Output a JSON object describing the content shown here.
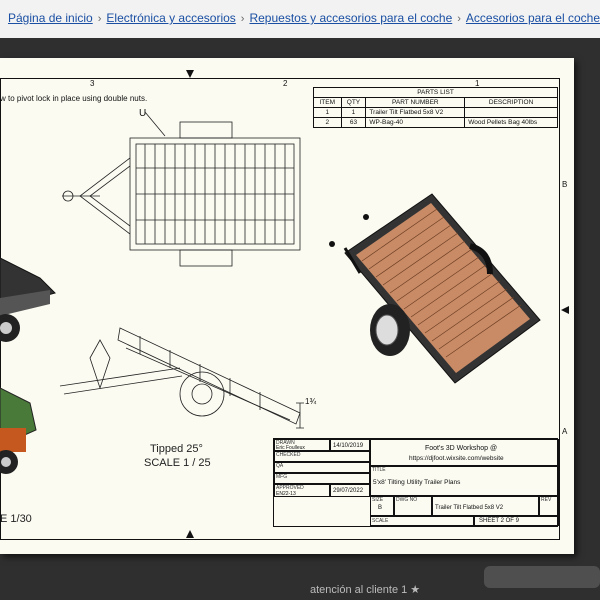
{
  "breadcrumb": [
    "Página de inicio",
    "Electrónica y accesorios",
    "Repuestos y accesorios para el coche",
    "Accesorios para el coche"
  ],
  "zones": {
    "top": [
      "3",
      "2",
      "1"
    ],
    "right": [
      "B",
      "A"
    ]
  },
  "note_pivot": "w to pivot lock in place using double nuts.",
  "label_u": "U",
  "dim_label": "1¾",
  "tipped": {
    "title": "Tipped 25°",
    "scale": "SCALE 1 / 25"
  },
  "left_scale": "E 1/30",
  "parts_list": {
    "title": "PARTS LIST",
    "headers": [
      "ITEM",
      "QTY",
      "PART NUMBER",
      "DESCRIPTION"
    ],
    "rows": [
      [
        "1",
        "1",
        "Trailer Tilt Flatbed 5x8 V2",
        ""
      ],
      [
        "2",
        "63",
        "WP-Bag-40",
        "Wood Pellets Bag 40lbs"
      ]
    ]
  },
  "title_block": {
    "drawn_label": "DRAWN",
    "drawn_name": "Eric Foulleux",
    "drawn_date": "14/10/2019",
    "checked": "CHECKED",
    "qa": "QA",
    "mfg": "MFG",
    "approved_label": "APPROVED",
    "approved_name": "EN22-13",
    "approved_date": "29/07/2022",
    "company": "Foot's 3D Workshop @",
    "website": "https://djfoot.wixsite.com/website",
    "title_label": "TITLE",
    "title": "5'x8' Tilting Utility Trailer Plans",
    "size_label": "SIZE",
    "size": "B",
    "dwg_label": "DWG NO",
    "dwg": "Trailer Tilt Flatbed 5x8 V2",
    "rev_label": "REV",
    "scale_label": "SCALE",
    "sheet": "SHEET 2  OF 9"
  },
  "bottom_text": "atención al cliente  1 ★"
}
